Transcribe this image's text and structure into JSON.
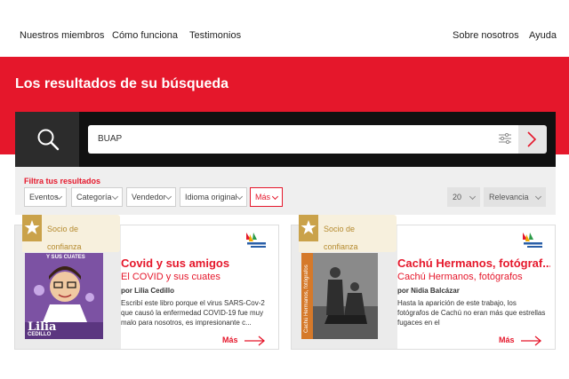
{
  "nav": {
    "left": [
      "Nuestros miembros",
      "Cómo funciona",
      "Testimonios"
    ],
    "right": [
      "Sobre nosotros",
      "Ayuda"
    ]
  },
  "hero": {
    "title": "Los resultados de su búsqueda"
  },
  "search": {
    "query": "BUAP"
  },
  "filters": {
    "title": "Filtra tus resultados",
    "dropdowns": [
      "Eventos",
      "Categoría",
      "Vendedor",
      "Idioma original",
      "Más"
    ],
    "per_page": "20",
    "sort": "Relevancia"
  },
  "results": [
    {
      "badge": "Socio de confianza",
      "title": "Covid y sus amigos",
      "subtitle": "El COVID y sus cuates",
      "author": "por Lilia Cedillo",
      "description": "Escribí este libro porque el virus SARS-Cov-2 que causó la enfermedad COVID-19 fue muy malo para nosotros, es impresionante c...",
      "more": "Más",
      "cover_text_top": "Y SUS CUATES",
      "cover_author_first": "Lilia",
      "cover_author_last": "CEDILLO"
    },
    {
      "badge": "Socio de confianza",
      "title": "Cachú Hermanos, fotógraf...",
      "subtitle": "Cachú Hermanos, fotógrafos",
      "author": "por Nidia Balcázar",
      "description": "Hasta la aparición de este trabajo, los fotógrafos de Cachú no eran más que estrellas fugaces en el",
      "more": "Más",
      "cover_spine": "Cachú Hermanos, fotógrafos"
    }
  ],
  "colors": {
    "accent": "#e5172b",
    "badge": "#caa24a"
  }
}
